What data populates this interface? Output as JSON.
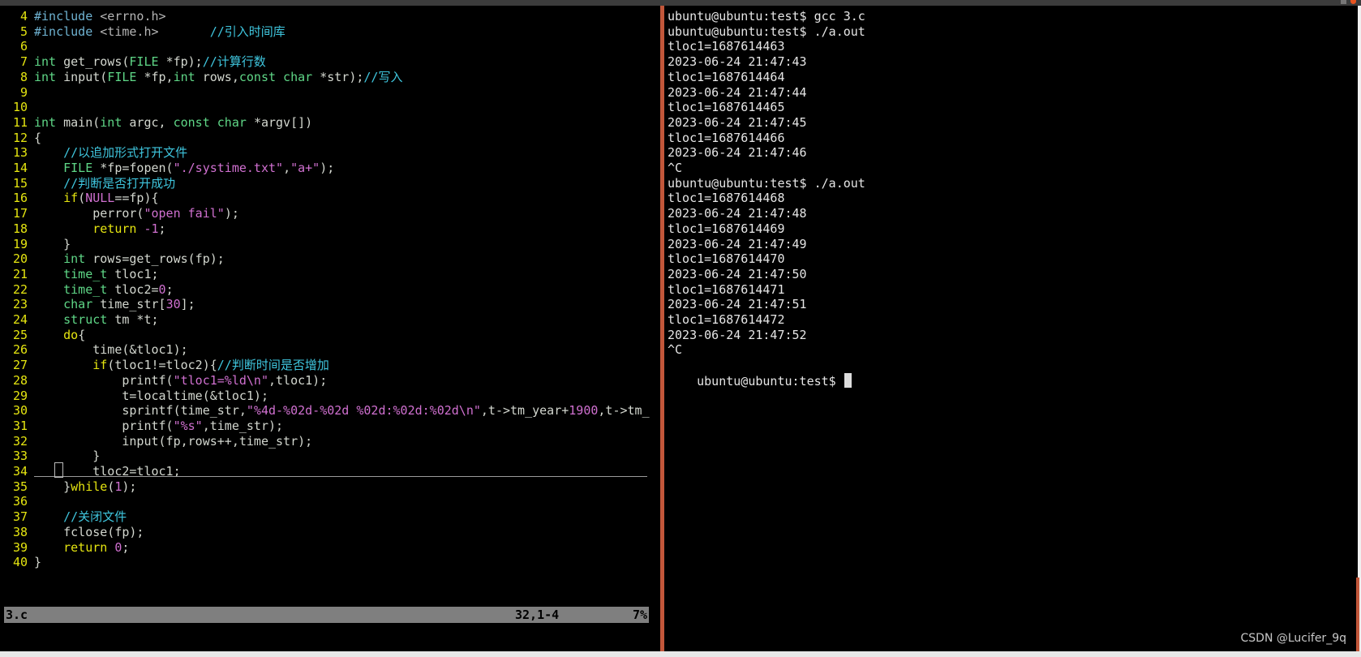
{
  "vim": {
    "lines": [
      {
        "n": "4",
        "segs": [
          [
            "#include ",
            "pp"
          ],
          [
            "<errno.h>",
            "inc"
          ]
        ]
      },
      {
        "n": "5",
        "segs": [
          [
            "#include ",
            "pp"
          ],
          [
            "<time.h>",
            "inc"
          ],
          [
            "       //引入时间库",
            "cm"
          ]
        ]
      },
      {
        "n": "6",
        "segs": []
      },
      {
        "n": "7",
        "segs": [
          [
            "int ",
            "ty"
          ],
          [
            "get_rows(",
            "code"
          ],
          [
            "FILE ",
            "ty"
          ],
          [
            "*fp);",
            "code"
          ],
          [
            "//计算行数",
            "cm"
          ]
        ]
      },
      {
        "n": "8",
        "segs": [
          [
            "int ",
            "ty"
          ],
          [
            "input(",
            "code"
          ],
          [
            "FILE ",
            "ty"
          ],
          [
            "*fp,",
            "code"
          ],
          [
            "int ",
            "ty"
          ],
          [
            "rows,",
            "code"
          ],
          [
            "const char ",
            "ty"
          ],
          [
            "*str);",
            "code"
          ],
          [
            "//写入",
            "cm"
          ]
        ]
      },
      {
        "n": "9",
        "segs": []
      },
      {
        "n": "10",
        "segs": []
      },
      {
        "n": "11",
        "segs": [
          [
            "int ",
            "ty"
          ],
          [
            "main(",
            "code"
          ],
          [
            "int ",
            "ty"
          ],
          [
            "argc, ",
            "code"
          ],
          [
            "const char ",
            "ty"
          ],
          [
            "*argv[])",
            "code"
          ]
        ]
      },
      {
        "n": "12",
        "segs": [
          [
            "{",
            "code"
          ]
        ]
      },
      {
        "n": "13",
        "segs": [
          [
            "    //以追加形式打开文件",
            "cm"
          ]
        ]
      },
      {
        "n": "14",
        "segs": [
          [
            "    ",
            "code"
          ],
          [
            "FILE ",
            "ty"
          ],
          [
            "*fp=fopen(",
            "code"
          ],
          [
            "\"./systime.txt\"",
            "st"
          ],
          [
            ",",
            "code"
          ],
          [
            "\"a+\"",
            "st"
          ],
          [
            ");",
            "code"
          ]
        ]
      },
      {
        "n": "15",
        "segs": [
          [
            "    //判断是否打开成功",
            "cm"
          ]
        ]
      },
      {
        "n": "16",
        "segs": [
          [
            "    ",
            "code"
          ],
          [
            "if",
            "kw"
          ],
          [
            "(",
            "code"
          ],
          [
            "NULL",
            "nm"
          ],
          [
            "==fp){",
            "code"
          ]
        ]
      },
      {
        "n": "17",
        "segs": [
          [
            "        perror(",
            "code"
          ],
          [
            "\"open fail\"",
            "st"
          ],
          [
            ");",
            "code"
          ]
        ]
      },
      {
        "n": "18",
        "segs": [
          [
            "        ",
            "code"
          ],
          [
            "return ",
            "kw"
          ],
          [
            "-1",
            "nm"
          ],
          [
            ";",
            "code"
          ]
        ]
      },
      {
        "n": "19",
        "segs": [
          [
            "    }",
            "code"
          ]
        ]
      },
      {
        "n": "20",
        "segs": [
          [
            "    ",
            "code"
          ],
          [
            "int ",
            "ty"
          ],
          [
            "rows=get_rows(fp);",
            "code"
          ]
        ]
      },
      {
        "n": "21",
        "segs": [
          [
            "    ",
            "code"
          ],
          [
            "time_t ",
            "ty"
          ],
          [
            "tloc1;",
            "code"
          ]
        ]
      },
      {
        "n": "22",
        "segs": [
          [
            "    ",
            "code"
          ],
          [
            "time_t ",
            "ty"
          ],
          [
            "tloc2=",
            "code"
          ],
          [
            "0",
            "nm"
          ],
          [
            ";",
            "code"
          ]
        ]
      },
      {
        "n": "23",
        "segs": [
          [
            "    ",
            "code"
          ],
          [
            "char ",
            "ty"
          ],
          [
            "time_str[",
            "code"
          ],
          [
            "30",
            "nm"
          ],
          [
            "];",
            "code"
          ]
        ]
      },
      {
        "n": "24",
        "segs": [
          [
            "    ",
            "code"
          ],
          [
            "struct ",
            "ty"
          ],
          [
            "tm *t;",
            "code"
          ]
        ]
      },
      {
        "n": "25",
        "segs": [
          [
            "    ",
            "code"
          ],
          [
            "do",
            "kw"
          ],
          [
            "{",
            "code"
          ]
        ]
      },
      {
        "n": "26",
        "segs": [
          [
            "        time(&tloc1);",
            "code"
          ]
        ]
      },
      {
        "n": "27",
        "segs": [
          [
            "        ",
            "code"
          ],
          [
            "if",
            "kw"
          ],
          [
            "(tloc1!=tloc2){",
            "code"
          ],
          [
            "//判断时间是否增加",
            "cm"
          ]
        ]
      },
      {
        "n": "28",
        "segs": [
          [
            "            printf(",
            "code"
          ],
          [
            "\"tloc1=%ld\\n\"",
            "st"
          ],
          [
            ",tloc1);",
            "code"
          ]
        ]
      },
      {
        "n": "29",
        "segs": [
          [
            "            t=localtime(&tloc1);",
            "code"
          ]
        ]
      },
      {
        "n": "30",
        "segs": [
          [
            "            sprintf(time_str,",
            "code"
          ],
          [
            "\"%4d-%02d-%02d %02d:%02d:%02d\\n\"",
            "st"
          ],
          [
            ",t->tm_year+",
            "code"
          ],
          [
            "1900",
            "nm"
          ],
          [
            ",t->tm_",
            "code"
          ]
        ]
      },
      {
        "n": "31",
        "segs": [
          [
            "            printf(",
            "code"
          ],
          [
            "\"%s\"",
            "st"
          ],
          [
            ",time_str);",
            "code"
          ]
        ]
      },
      {
        "n": "32",
        "segs": [
          [
            "            input(fp,rows++,time_str);",
            "code"
          ]
        ]
      },
      {
        "n": "33",
        "segs": [
          [
            "        }",
            "code"
          ]
        ]
      },
      {
        "n": "34",
        "segs": [
          [
            "        tloc2=tloc1;",
            "code"
          ]
        ]
      },
      {
        "n": "35",
        "segs": [
          [
            "    }",
            "code"
          ],
          [
            "while",
            "kw"
          ],
          [
            "(",
            "code"
          ],
          [
            "1",
            "nm"
          ],
          [
            ");",
            "code"
          ]
        ]
      },
      {
        "n": "36",
        "segs": []
      },
      {
        "n": "37",
        "segs": [
          [
            "    //关闭文件",
            "cm"
          ]
        ]
      },
      {
        "n": "38",
        "segs": [
          [
            "    fclose(fp);",
            "code"
          ]
        ]
      },
      {
        "n": "39",
        "segs": [
          [
            "    ",
            "code"
          ],
          [
            "return ",
            "kw"
          ],
          [
            "0",
            "nm"
          ],
          [
            ";",
            "code"
          ]
        ]
      },
      {
        "n": "40",
        "segs": [
          [
            "}",
            "code"
          ]
        ]
      }
    ],
    "status": {
      "file": "3.c",
      "position": "32,1-4",
      "percent": "7%"
    }
  },
  "terminal": {
    "lines": [
      "ubuntu@ubuntu:test$ gcc 3.c",
      "ubuntu@ubuntu:test$ ./a.out",
      "tloc1=1687614463",
      "2023-06-24 21:47:43",
      "tloc1=1687614464",
      "2023-06-24 21:47:44",
      "tloc1=1687614465",
      "2023-06-24 21:47:45",
      "tloc1=1687614466",
      "2023-06-24 21:47:46",
      "^C",
      "ubuntu@ubuntu:test$ ./a.out",
      "tloc1=1687614468",
      "2023-06-24 21:47:48",
      "tloc1=1687614469",
      "2023-06-24 21:47:49",
      "tloc1=1687614470",
      "2023-06-24 21:47:50",
      "tloc1=1687614471",
      "2023-06-24 21:47:51",
      "tloc1=1687614472",
      "2023-06-24 21:47:52",
      "^C"
    ],
    "prompt": "ubuntu@ubuntu:test$ "
  },
  "watermark": "CSDN @Lucifer_9q",
  "colors": {
    "accent": "#c2573a",
    "linenum": "#e5e510",
    "comment": "#3fc6de",
    "type": "#5fd787",
    "string": "#d070d0"
  }
}
